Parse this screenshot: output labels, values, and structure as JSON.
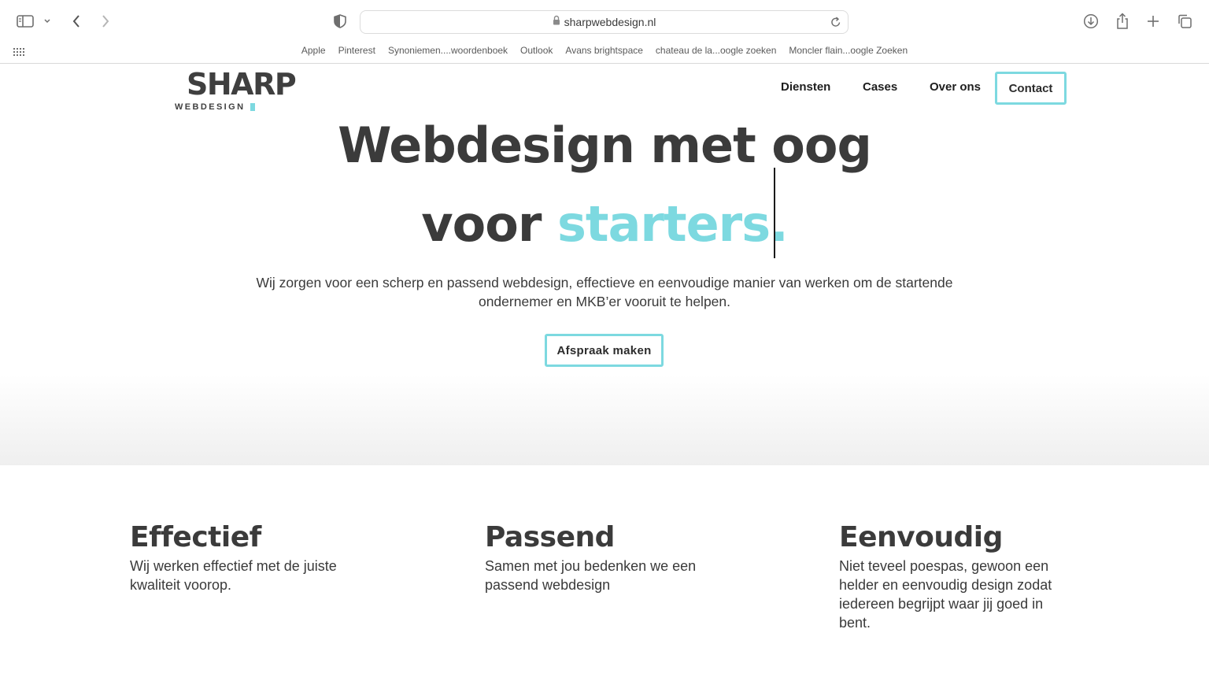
{
  "browser": {
    "url": "sharpwebdesign.nl",
    "bookmarks": [
      "Apple",
      "Pinterest",
      "Synoniemen....woordenboek",
      "Outlook",
      "Avans brightspace",
      "chateau de la...oogle zoeken",
      "Moncler flain...oogle Zoeken"
    ]
  },
  "site": {
    "logo_main": "SHARP",
    "logo_sub": "WEBDESIGN",
    "nav": {
      "diensten": "Diensten",
      "cases": "Cases",
      "over_ons": "Over ons",
      "contact": "Contact"
    },
    "hero": {
      "line1": "Webdesign met oog",
      "line2_prefix": "voor ",
      "line2_accent": "starters.",
      "subtitle": "Wij zorgen voor een scherp en passend webdesign, effectieve en eenvoudige manier van werken om de startende ondernemer en MKB’er vooruit te helpen.",
      "cta": "Afspraak maken"
    },
    "features": [
      {
        "title": "Effectief",
        "text": "Wij werken effectief met de juiste kwaliteit voorop."
      },
      {
        "title": "Passend",
        "text": "Samen met jou bedenken we een passend webdesign"
      },
      {
        "title": "Eenvoudig",
        "text": "Niet teveel poespas, gewoon een helder en eenvoudig design zodat iedereen begrijpt waar jij goed in bent."
      }
    ]
  },
  "colors": {
    "accent": "#7dd9e0",
    "text": "#3b3b3b"
  }
}
